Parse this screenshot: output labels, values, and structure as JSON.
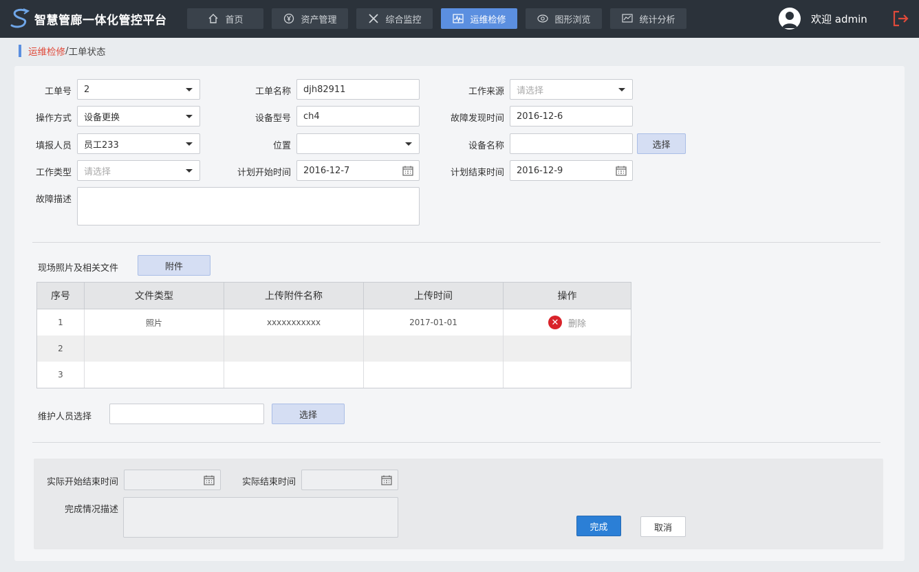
{
  "app": {
    "title": "智慧管廊一体化管控平台",
    "user_greeting": "欢迎 admin"
  },
  "nav": [
    {
      "label": "首页",
      "icon": "home-icon"
    },
    {
      "label": "资产管理",
      "icon": "yen-icon"
    },
    {
      "label": "综合监控",
      "icon": "tools-icon"
    },
    {
      "label": "运维检修",
      "icon": "pulse-icon",
      "active": true
    },
    {
      "label": "图形浏览",
      "icon": "eye-icon"
    },
    {
      "label": "统计分析",
      "icon": "chart-icon"
    }
  ],
  "breadcrumb": {
    "parent": "运维检修",
    "separator": "/",
    "current": "工单状态"
  },
  "form": {
    "work_order_no": {
      "label": "工单号",
      "value": "2"
    },
    "work_order_name": {
      "label": "工单名称",
      "value": "djh82911"
    },
    "work_source": {
      "label": "工作来源",
      "placeholder": "请选择"
    },
    "operation_mode": {
      "label": "操作方式",
      "value": "设备更换"
    },
    "device_model": {
      "label": "设备型号",
      "value": "ch4"
    },
    "fault_found_time": {
      "label": "故障发现时间",
      "value": "2016-12-6"
    },
    "reporter": {
      "label": "填报人员",
      "value": "员工233"
    },
    "location": {
      "label": "位置",
      "value": ""
    },
    "device_name": {
      "label": "设备名称",
      "value": "",
      "button": "选择"
    },
    "work_type": {
      "label": "工作类型",
      "placeholder": "请选择"
    },
    "plan_start": {
      "label": "计划开始时间",
      "value": "2016-12-7"
    },
    "plan_end": {
      "label": "计划结束时间",
      "value": "2016-12-9"
    },
    "fault_desc": {
      "label": "故障描述",
      "value": ""
    }
  },
  "attachments": {
    "label": "现场照片及相关文件",
    "button": "附件",
    "columns": [
      "序号",
      "文件类型",
      "上传附件名称",
      "上传时间",
      "操作"
    ],
    "rows": [
      {
        "no": "1",
        "type": "照片",
        "name": "xxxxxxxxxxx",
        "time": "2017-01-01",
        "action": "删除"
      },
      {
        "no": "2",
        "type": "",
        "name": "",
        "time": "",
        "action": ""
      },
      {
        "no": "3",
        "type": "",
        "name": "",
        "time": "",
        "action": ""
      }
    ]
  },
  "maintainer": {
    "label": "维护人员选择",
    "value": "",
    "button": "选择"
  },
  "completion": {
    "actual_start_label": "实际开始结束时间",
    "actual_end_label": "实际结束时间",
    "desc_label": "完成情况描述",
    "done_button": "完成",
    "cancel_button": "取消"
  },
  "colors": {
    "topbar": "#2b323a",
    "accent": "#5b8fe0",
    "breadcrumb_link": "#e04a3a",
    "primary_button": "#2b7fd6",
    "delete_icon": "#d9232a"
  }
}
